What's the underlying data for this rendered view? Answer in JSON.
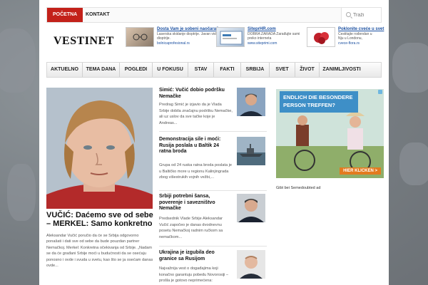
{
  "top_nav": {
    "items": [
      "POČETNA",
      "KONTAKT"
    ],
    "search_placeholder": "Traži"
  },
  "logo": "VESTINET",
  "ads": [
    {
      "title": "Dosta Vam je sobeni naočara?",
      "desc": "Laserska skidanje dioptrije. Javan vid dioptrije.",
      "url": "bolnicaprofesional.rs"
    },
    {
      "title": "SiteprHR.com",
      "desc": "DOBRA ZARADA Zarađujte sami preko interneta",
      "url": "www.siteprimi.com"
    },
    {
      "title": "Poklonite cveće u svet",
      "desc": "Čestitajte rođendan u Nju u Londonu, godišnjicu u B.",
      "url": "cvece-flora.rs"
    }
  ],
  "main_nav": [
    "AKTUELNO",
    "TEMA DANA",
    "POGLEDI",
    "U FOKUSU",
    "STAV",
    "FAKTI",
    "SRBIJA",
    "SVET",
    "ŽIVOT",
    "ZANIMLJIVOSTI"
  ],
  "featured": {
    "title": "VUČIĆ: Daćemo sve od sebe – MERKEL: Samo konkretno",
    "text": "Aleksandar Vučić poručio da će se Srbija odgovorno ponašati i dati sve od sebe da bude pouzdan partner Nemačkoj. Merkel: Konkretna očekivanja od Srbije. „Nadam se da će građani Srbije moći u budućnosti da se osećaju ponosno i ovde i svuda u svetu, kao što se ja osećam danas ovde..."
  },
  "news": [
    {
      "title": "Simić: Vučić dobio podršku Nemačke",
      "text": "Predrag Simić je izjavio da je Vlada Srbije dobila značajnu podršku Nemačke, ali uz uslov da sve tačke koje je Andreas..."
    },
    {
      "title": "Demonstracija sile i moći: Rusija poslala u Baltik 24 ratna broda",
      "text": "Grupa od 24 ruska ratna broda poslata je u Baltičko more u regionu Kalinjingrada zbog višestrukih vojnih vežbi,..."
    },
    {
      "title": "Srbiji potrebni šansa, poverenje i savezništvo Nemačke",
      "text": "Predsednik Vlade Srbije Aleksandar Vučić započeo je danas dvodnevnu posetu Nemačkoj radnim ručkom sa nemačkom..."
    },
    {
      "title": "Ukrajina je izgubila deo granice sa Rusijom",
      "text": "Najvažnija vest o događajima koji konačno garantuju pobedu Novorosiji – prošla je gotovo neprimećena:"
    }
  ],
  "side_ad": {
    "headline": "ENDLICH DIE BESONDERE PERSON TREFFEN?",
    "cta": "HIER KLICKEN >",
    "caption": "Gibt bei Semedoubted ad"
  },
  "colors": {
    "accent": "#c3211a",
    "link": "#1a4fa0",
    "ad_blue": "#3e8fc7",
    "ad_orange": "#e37b1f"
  }
}
